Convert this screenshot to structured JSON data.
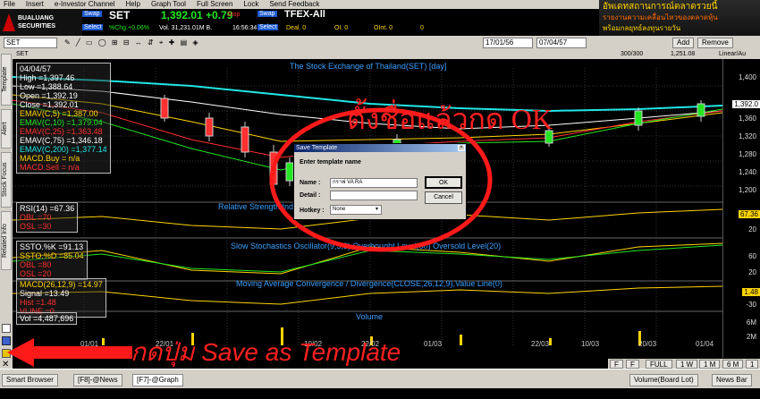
{
  "menu": [
    "File",
    "Insert",
    "e-Investor Channel",
    "Help",
    "Graph Tool",
    "Full Screen",
    "Lock",
    "Send Feedback"
  ],
  "banner": {
    "line1": "อัพเดทสถานการณ์ตลาดรวยนี้",
    "line2": "รายงานความเคลื่อนไหวของตลาดหุ้น",
    "line3": "พร้อมกลยุทธ์ลงทุนรายวัน"
  },
  "logo": {
    "name": "BUALUANG",
    "sub": "SECURITIES"
  },
  "quote": {
    "swap_label": "Swap",
    "symbol": "SET",
    "price": "1,392.01 +0.79",
    "pct_change": "%Chg.+0.06%",
    "volume": "Vol. 31,231.01M B.",
    "time": "16:56:34",
    "stop_label": "Stop",
    "swap2_label": "Swap",
    "series": "TFEX-All",
    "select_label": "Select",
    "deal_label": "Deal. 0",
    "oi_label": "OI. 0",
    "oi_int": "OInt. 0",
    "last_label": "0"
  },
  "toolbar": {
    "start_date": "17/01/56",
    "end_date": "07/04/57",
    "add_label": "Add",
    "remove_label": "Remove",
    "symbol_input": "SET",
    "bars": "300/300",
    "last_val": "1,251.08",
    "scale": "Linear/Au"
  },
  "left_tabs": [
    "Template",
    "Alert",
    "Stock Focus",
    "Related Info"
  ],
  "price_panel": {
    "title": "The Stock Exchange of Thailand(SET) [day]",
    "info": [
      "04/04/57",
      "High =1,397.46",
      "Low =1,388.64",
      "Open =1,392.19",
      "Close =1,392.01",
      "EMAV(C,5) =1,387.00",
      "EMAV(C,10) =1,379.04",
      "EMAV(C,25) =1,363.48",
      "EMAV(C,75) =1,346.18",
      "EMAV(C,200) =1,377.14",
      "MACD.Buy = n/a",
      "MACD.Sell = n/a"
    ],
    "yticks": [
      "1,400",
      "1,392.0",
      "1,360",
      "1,320",
      "1,280",
      "1,240",
      "1,200"
    ]
  },
  "rsi_panel": {
    "title": "Relative Strength Index(14) Overbought Level(70) Oversold Level(30)",
    "info": [
      "RSI(14) =67.36",
      "OBL =70",
      "OSL =30"
    ],
    "yticks": [
      "67.36",
      "20"
    ]
  },
  "sto_panel": {
    "title": "Slow Stochastics Oscillator(9,3,3) Overbought Level(80) Oversold Level(20)",
    "info": [
      "SSTO.%K =91.13",
      "SSTO.%D =85.04",
      "OBL =80",
      "OSL =20"
    ],
    "yticks": [
      "60",
      "20"
    ]
  },
  "macd_panel": {
    "title": "Moving Average Convergence / Divergence(CLOSE,26,12,9),Value Line(0)",
    "info": [
      "MACD(26,12,9) =14.97",
      "Signal =13.49",
      "Hist =1.48",
      "VLINE =0"
    ],
    "yticks": [
      "1.48",
      "-30"
    ]
  },
  "vol_panel": {
    "title": "Volume",
    "info": [
      "Vol =4,487,696"
    ],
    "yticks": [
      "6M",
      "2M"
    ]
  },
  "xaxis": [
    "01/01",
    "22/01",
    "10/02",
    "22/02",
    "01/03",
    "22/03",
    "10/03",
    "20/03",
    "01/04"
  ],
  "dialog": {
    "title": "Save Template",
    "heading": "Enter template name",
    "name_label": "Name :",
    "name_value": "กราฟ VA RA",
    "detail_label": "Detail :",
    "detail_value": "",
    "hotkey_label": "Hotkey :",
    "hotkey_value": "None",
    "ok_label": "OK",
    "cancel_label": "Cancel"
  },
  "annotations": {
    "top": "ตั้งชื่อแล้วกด OK",
    "bottom": "กดปุ่ม Save as Template"
  },
  "range_bar": [
    "F",
    "F",
    "FULL",
    "1 W",
    "1 M",
    "6 M",
    "1"
  ],
  "statusbar": {
    "smart_browser": "Smart Browser",
    "tab1": "[F8]-@News",
    "tab2": "[F7]-@Graph",
    "volume_board": "Volume(Board Lot)",
    "news_bar": "News Bar"
  },
  "colors": {
    "accent_red": "#ff2020",
    "panel_title": "#3aa0ff",
    "price_line": "#22e6e6"
  }
}
